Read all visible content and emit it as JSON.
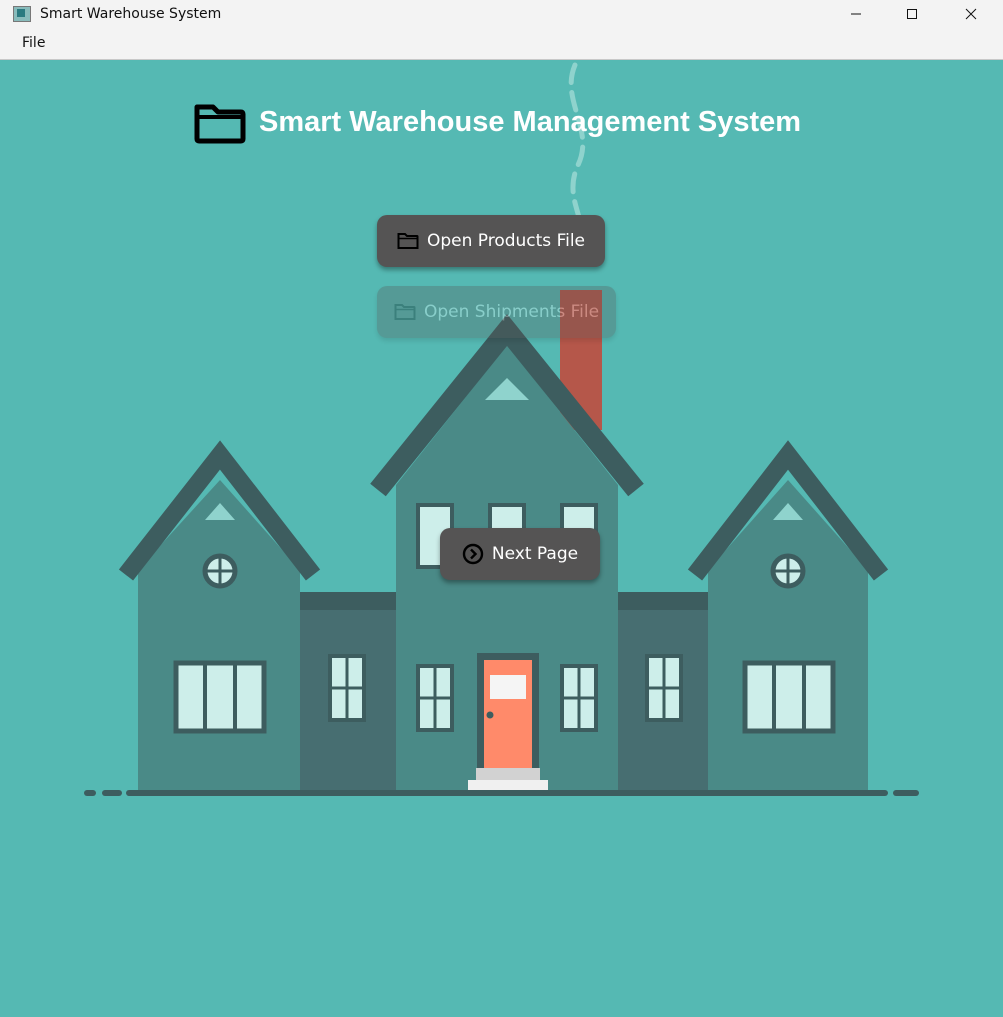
{
  "window": {
    "title": "Smart Warehouse System"
  },
  "menu": {
    "file": "File"
  },
  "main": {
    "heading": "Smart Warehouse Management System"
  },
  "buttons": {
    "open_products": "Open Products File",
    "open_shipments": "Open Shipments File",
    "next_page": "Next Page"
  },
  "icons": {
    "heading": "folder-icon",
    "open_products": "folder-icon",
    "open_shipments": "folder-icon",
    "next_page": "chevron-right-circle-icon"
  },
  "colors": {
    "background": "#55b9b3",
    "button": "#555454",
    "house_wall": "#4a8a87",
    "door": "#ff8a6a",
    "chimney": "#b5574a"
  }
}
